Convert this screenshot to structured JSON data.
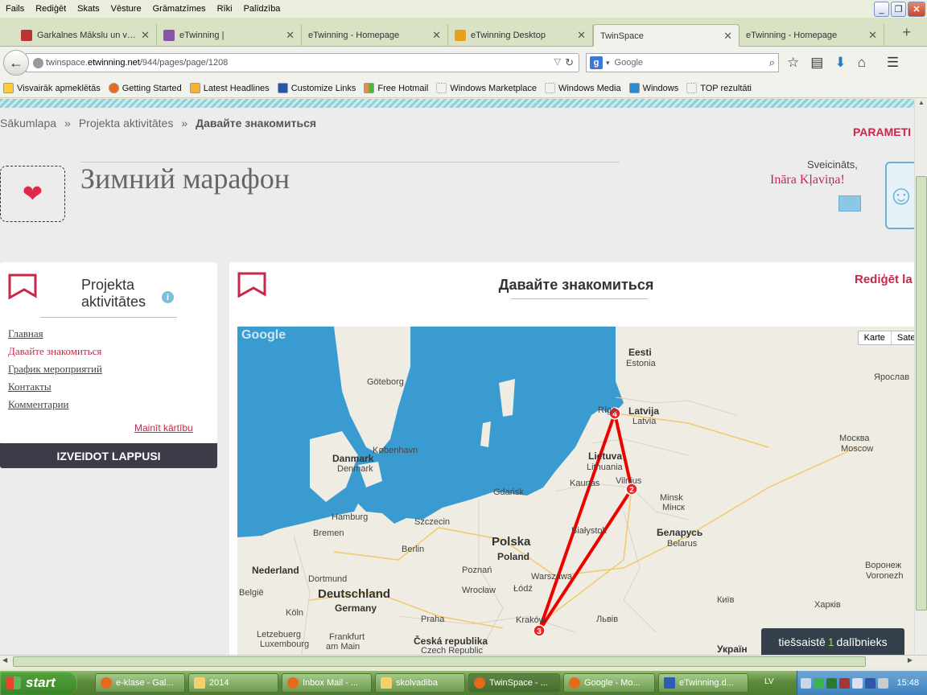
{
  "menu": [
    "Fails",
    "Rediģēt",
    "Skats",
    "Vēsture",
    "Grāmatzīmes",
    "Rīki",
    "Palīdzība"
  ],
  "tabs": [
    {
      "label": "Garkalnes Mākslu un vis...",
      "color": "#b33"
    },
    {
      "label": "eTwinning |",
      "color": "#8854a8"
    },
    {
      "label": "eTwinning - Homepage",
      "color": ""
    },
    {
      "label": "eTwinning Desktop",
      "color": "#e8a020"
    },
    {
      "label": "TwinSpace",
      "color": ""
    },
    {
      "label": "eTwinning - Homepage",
      "color": ""
    }
  ],
  "url": {
    "prefix": "twinspace.",
    "host": "etwinning.net",
    "path": "/944/pages/page/1208"
  },
  "search": {
    "placeholder": "Google"
  },
  "bookmarks": [
    "Visvairāk apmeklētās",
    "Getting Started",
    "Latest Headlines",
    "Customize Links",
    "Free Hotmail",
    "Windows Marketplace",
    "Windows Media",
    "Windows",
    "TOP rezultāti"
  ],
  "breadcrumb": {
    "home": "Sākumlapa",
    "sep": "»",
    "section": "Projekta aktivitātes",
    "current": "Давайте знакомиться"
  },
  "params_label": "PARAMETI",
  "page_title": "Зимний марафон",
  "greeting": "Sveicināts,",
  "user_name": "Ināra Kļaviņa!",
  "side": {
    "heading_line1": "Projekta",
    "heading_line2": "aktivitātes",
    "links": [
      "Главная",
      "Давайте знакомиться",
      "График мероприятий",
      "Контакты",
      "Комментарии"
    ],
    "reorder": "Mainīt kārtību",
    "create": "IZVEIDOT LAPPUSI"
  },
  "main": {
    "title": "Давайте знакомиться",
    "edit": "Rediģēt la"
  },
  "map": {
    "types": [
      "Karte",
      "Satel"
    ],
    "logo": "Google",
    "labels": [
      "Eesti",
      "Estonia",
      "Latvija",
      "Latvia",
      "Rīga",
      "Lietuva",
      "Lithuania",
      "Kaunas",
      "Vilnius",
      "Göteborg",
      "København",
      "Danmark",
      "Denmark",
      "Gdańsk",
      "Hamburg",
      "Szczecin",
      "Bremen",
      "Berlin",
      "Polska",
      "Poland",
      "Poznań",
      "Warszawa",
      "Białystok",
      "Minsk",
      "Мінск",
      "Беларусь",
      "Belarus",
      "Nederland",
      "Dortmund",
      "Deutschland",
      "Germany",
      "Wrocław",
      "Łódź",
      "Kraków",
      "Praha",
      "Česká republika",
      "Czech Republic",
      "België",
      "Köln",
      "Letzebuerg",
      "Luxembourg",
      "Frankfurt",
      "am Main",
      "Москва",
      "Moscow",
      "Ярослав",
      "Воронеж",
      "Voronezh",
      "Київ",
      "Харків",
      "Львів",
      "Україн"
    ],
    "markers": [
      "4",
      "2",
      "3"
    ]
  },
  "online": {
    "prefix": "tiešsaistē",
    "count": "1",
    "suffix": "dalībnieks"
  },
  "taskbar": {
    "start": "start",
    "items": [
      "e-klase - Gal...",
      "2014",
      "Inbox Mail - ...",
      "skolvadiba",
      "TwinSpace - ...",
      "Google - Mo...",
      "eTwinning.d..."
    ],
    "lang": "LV",
    "clock": "15:48"
  }
}
